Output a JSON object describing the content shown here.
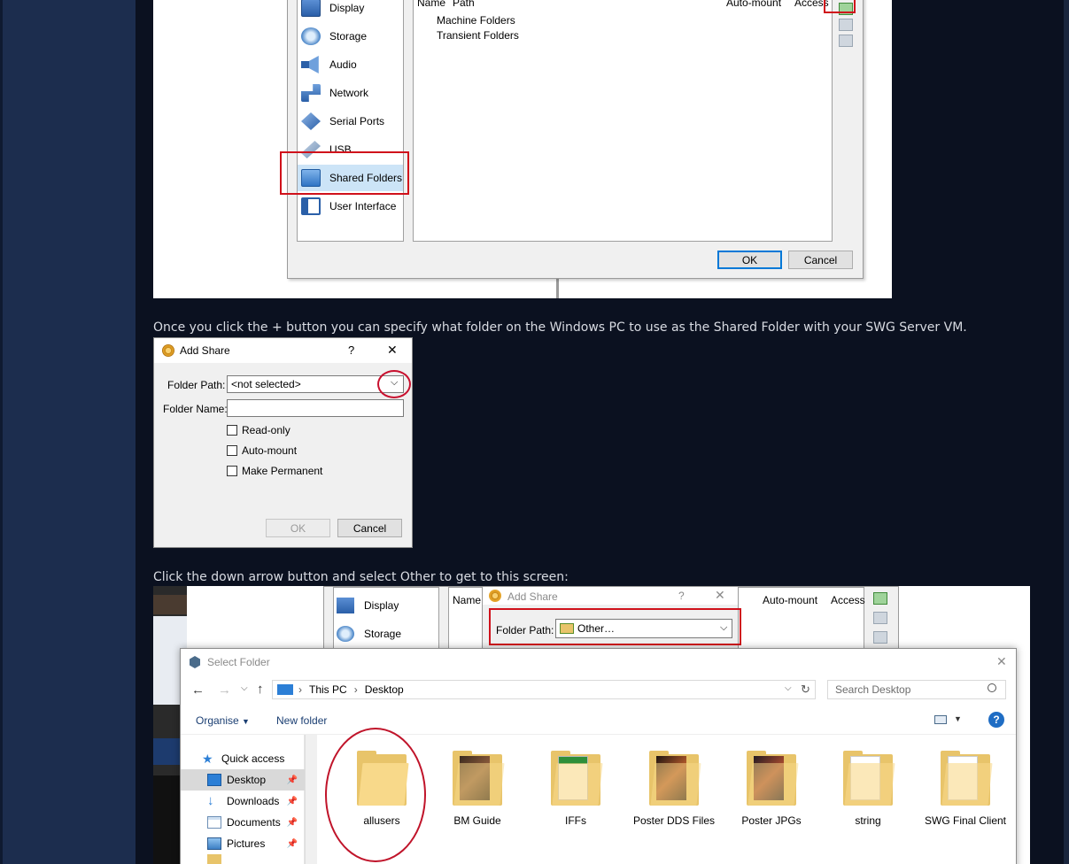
{
  "settings_dialog": {
    "sidebar": [
      {
        "label": "Display",
        "icon": "display-icon"
      },
      {
        "label": "Storage",
        "icon": "storage-icon"
      },
      {
        "label": "Audio",
        "icon": "audio-icon"
      },
      {
        "label": "Network",
        "icon": "network-icon"
      },
      {
        "label": "Serial Ports",
        "icon": "serial-ports-icon"
      },
      {
        "label": "USB",
        "icon": "usb-icon"
      },
      {
        "label": "Shared Folders",
        "icon": "shared-folders-icon"
      },
      {
        "label": "User Interface",
        "icon": "user-interface-icon"
      }
    ],
    "selected": "Shared Folders",
    "columns": [
      "Name",
      "Path",
      "Auto-mount",
      "Access"
    ],
    "tree": [
      "Machine Folders",
      "Transient Folders"
    ],
    "ok_label": "OK",
    "cancel_label": "Cancel"
  },
  "caption1": "Once you click the + button you can specify what folder on the Windows PC to use as the Shared Folder with your SWG Server VM.",
  "add_share": {
    "title": "Add Share",
    "help": "?",
    "close": "✕",
    "folder_path_label": "Folder Path:",
    "folder_path_value": "<not selected>",
    "folder_name_label": "Folder Name:",
    "folder_name_value": "",
    "checkboxes": [
      "Read-only",
      "Auto-mount",
      "Make Permanent"
    ],
    "ok_label": "OK",
    "cancel_label": "Cancel"
  },
  "caption2": "Click the down arrow button and select Other to get to this screen:",
  "screenshot3": {
    "bg_sidebar": [
      "Display",
      "Storage"
    ],
    "bg_columns": [
      "Name",
      "Auto-mount",
      "Access"
    ],
    "add_share_title": "Add Share",
    "add_share_help": "?",
    "folder_path_label": "Folder Path:",
    "folder_path_value": "Other…",
    "select_folder": {
      "title": "Select Folder",
      "breadcrumb": [
        "This PC",
        "Desktop"
      ],
      "search_placeholder": "Search Desktop",
      "organise_label": "Organise",
      "new_folder_label": "New folder",
      "nav": [
        {
          "label": "Quick access",
          "icon": "star-icon",
          "pinned": false
        },
        {
          "label": "Desktop",
          "icon": "desktop-icon",
          "pinned": true
        },
        {
          "label": "Downloads",
          "icon": "downloads-icon",
          "pinned": true
        },
        {
          "label": "Documents",
          "icon": "documents-icon",
          "pinned": true
        },
        {
          "label": "Pictures",
          "icon": "pictures-icon",
          "pinned": true
        }
      ],
      "selected_nav": "Desktop",
      "folders": [
        "allusers",
        "BM Guide",
        "IFFs",
        "Poster DDS Files",
        "Poster JPGs",
        "string",
        "SWG Final Client"
      ]
    }
  },
  "colors": {
    "page_bg": "#0b1120",
    "rail": "#1c2d4e",
    "highlight_red": "#d0111b",
    "select_blue": "#cce4f7"
  }
}
